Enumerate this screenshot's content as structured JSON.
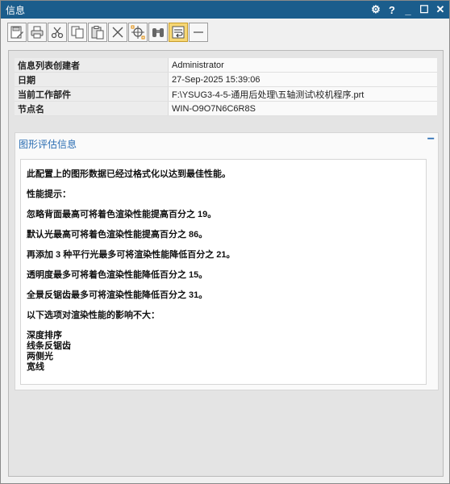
{
  "window": {
    "title": "信息",
    "controls": [
      "⚙",
      "?",
      "_",
      "☐",
      "✕"
    ]
  },
  "toolbar": {
    "buttons": [
      {
        "name": "save-button",
        "icon": "save-edit-icon",
        "active": false
      },
      {
        "name": "print-button",
        "icon": "print-icon",
        "active": false
      },
      {
        "name": "cut-button",
        "icon": "scissors-icon",
        "active": false
      },
      {
        "name": "copy-button",
        "icon": "copy-icon",
        "active": false
      },
      {
        "name": "paste-button",
        "icon": "paste-icon",
        "active": false
      },
      {
        "name": "delete-button",
        "icon": "delete-x-icon",
        "active": false
      },
      {
        "name": "target-button",
        "icon": "crosshair-icon",
        "active": false
      },
      {
        "name": "find-button",
        "icon": "binoculars-icon",
        "active": false
      },
      {
        "name": "wrap-button",
        "icon": "word-wrap-icon",
        "active": true
      },
      {
        "name": "minimize-text-button",
        "icon": "minus-icon",
        "active": false
      }
    ]
  },
  "meta": [
    {
      "key": "信息列表创建者",
      "value": "Administrator"
    },
    {
      "key": "日期",
      "value": "27-Sep-2025 15:39:06"
    },
    {
      "key": "当前工作部件",
      "value": "F:\\YSUG3-4-5-通用后处理\\五轴测试\\校机程序.prt"
    },
    {
      "key": "节点名",
      "value": "WIN-O9O7N6C6R8S"
    }
  ],
  "section": {
    "title": "图形评估信息",
    "lines": {
      "intro": "此配置上的图形数据已经过格式化以达到最佳性能。",
      "tips_header": "性能提示：",
      "tip1": "忽略背面最高可将着色渲染性能提高百分之 19。",
      "tip2": "默认光最高可将着色渲染性能提高百分之 86。",
      "tip3": "再添加 3 种平行光最多可将渲染性能降低百分之 21。",
      "tip4": "透明度最多可将着色渲染性能降低百分之 15。",
      "tip5": "全景反锯齿最多可将渲染性能降低百分之 31。",
      "minor_header": "以下选项对渲染性能的影响不大：",
      "minor1": "深度排序",
      "minor2": "线条反锯齿",
      "minor3": "两侧光",
      "minor4": "宽线"
    }
  }
}
